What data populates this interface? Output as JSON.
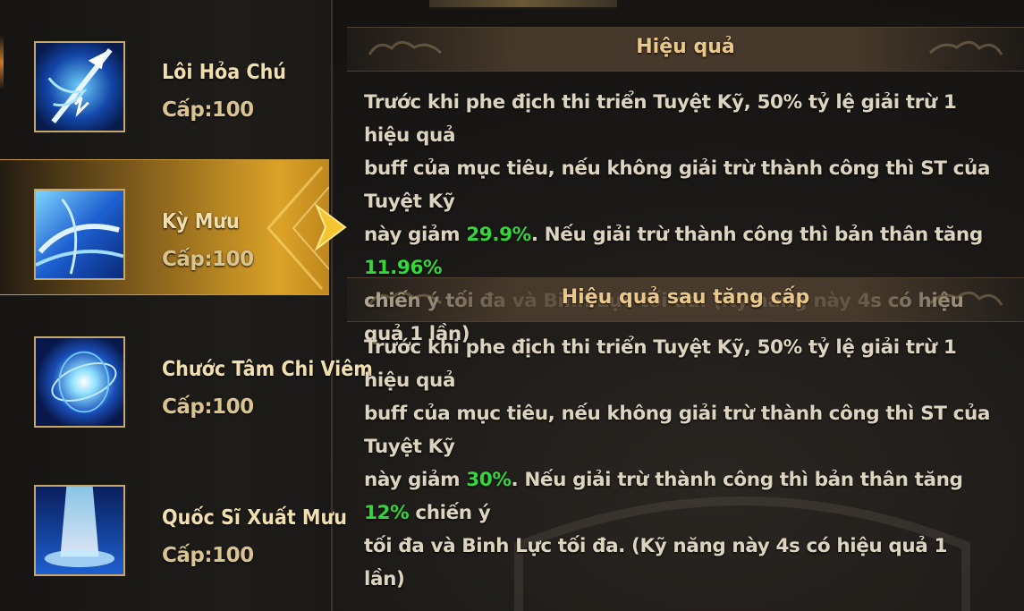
{
  "skills": [
    {
      "name": "Lôi Hỏa Chú",
      "level": "Cấp:100",
      "icon": "lightning-trident-icon",
      "selected": false
    },
    {
      "name": "Kỳ Mưu",
      "level": "Cấp:100",
      "icon": "blue-vortex-icon",
      "selected": true
    },
    {
      "name": "Chước Tâm Chi Viêm",
      "level": "Cấp:100",
      "icon": "blue-burst-icon",
      "selected": false
    },
    {
      "name": "Quốc Sĩ Xuất Mưu",
      "level": "Cấp:100",
      "icon": "light-pillar-icon",
      "selected": false
    }
  ],
  "effect": {
    "title": "Hiệu quả",
    "line1": "Trước khi phe địch thi triển Tuyệt Kỹ, 50% tỷ lệ giải trừ 1 hiệu quả",
    "line2": "buff của mục tiêu, nếu không giải trừ thành công thì ST của Tuyệt Kỹ",
    "line3_a": "này giảm ",
    "line3_v1": "29.9%",
    "line3_b": ". Nếu giải trừ thành công thì bản thân tăng ",
    "line3_v2": "11.96%",
    "line4": "chiến ý tối đa và Binh Lực tối đa. (Kỹ năng này 4s có hiệu quả 1 lần)"
  },
  "upgrade": {
    "title": "Hiệu quả sau tăng cấp",
    "line1": "Trước khi phe địch thi triển Tuyệt Kỹ, 50% tỷ lệ giải trừ 1 hiệu quả",
    "line2": "buff của mục tiêu, nếu không giải trừ thành công thì ST của Tuyệt Kỹ",
    "line3_a": "này giảm ",
    "line3_v1": "30%",
    "line3_b": ". Nếu giải trừ thành công thì bản thân tăng ",
    "line3_v2": "12%",
    "line3_c": " chiến ý",
    "line4": "tối đa và Binh Lực tối đa. (Kỹ năng này 4s có hiệu quả 1 lần)"
  },
  "colors": {
    "highlight": "#35d63a",
    "gold": "#e9c88a",
    "text": "#ddd4c0"
  }
}
